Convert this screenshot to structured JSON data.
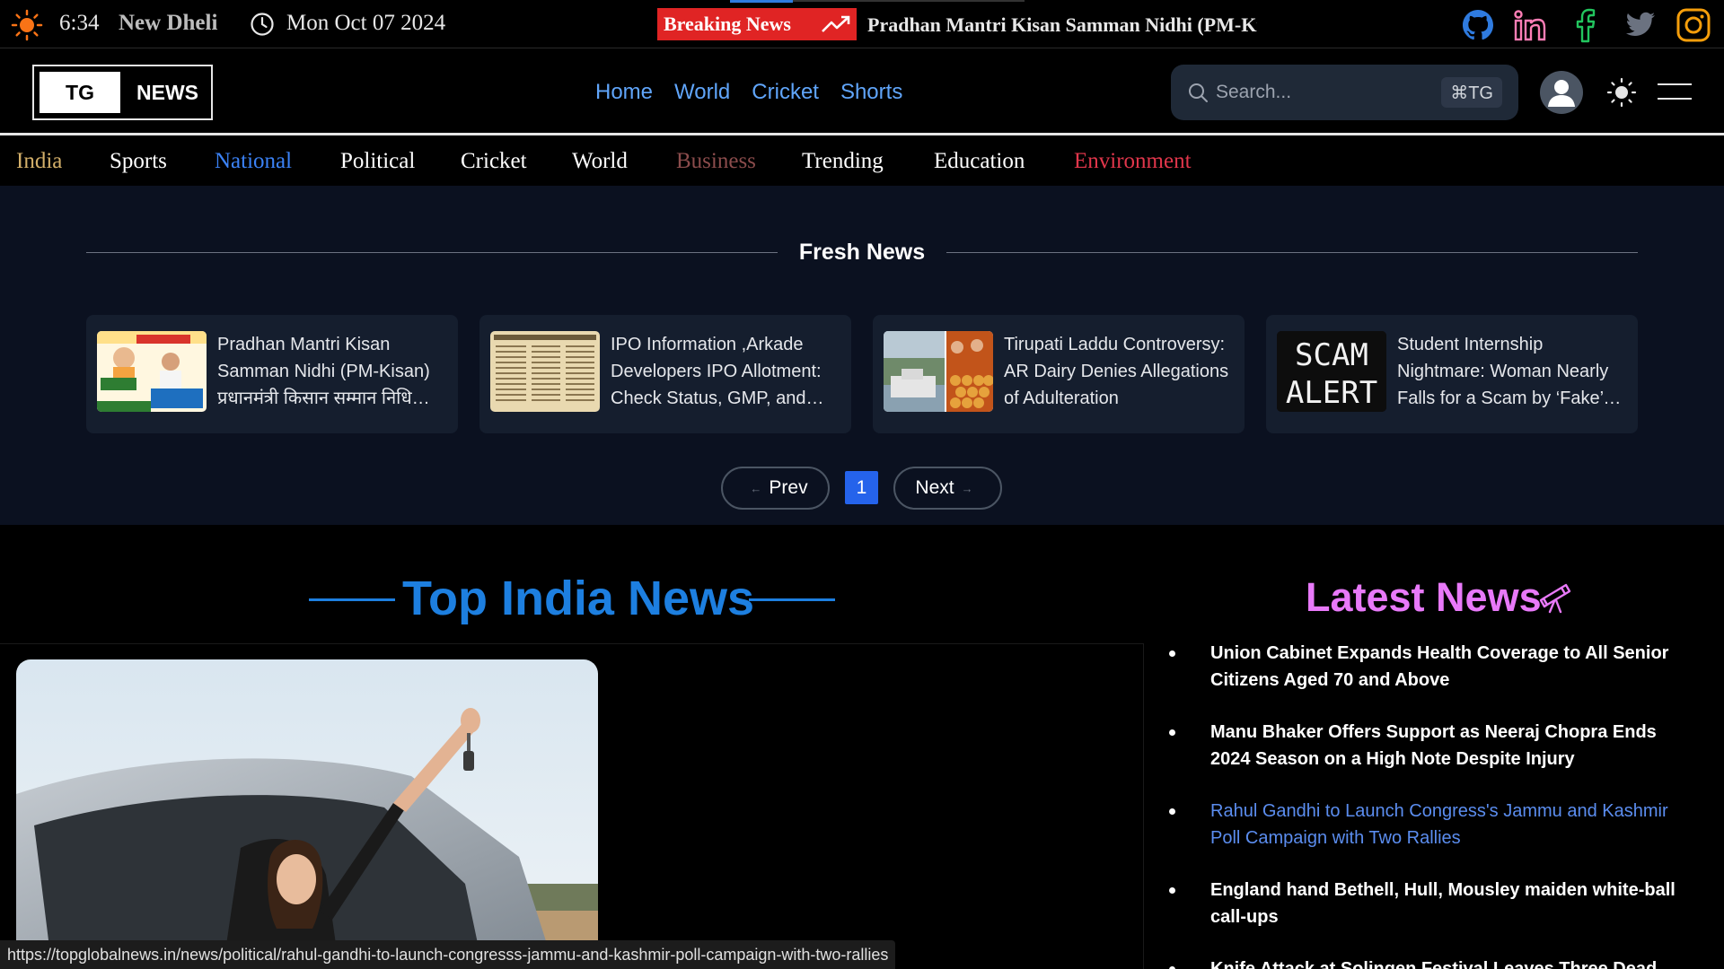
{
  "topbar": {
    "time": "6:34",
    "city": "New Dheli",
    "date": "Mon Oct 07 2024",
    "breaking_label": "Breaking News",
    "ticker_text": "Pradhan Mantri Kisan Samman Nidhi (PM-Kisan) प्रधानमंत्री किसान सम्मान निधि",
    "social_icons": [
      "github-icon",
      "linkedin-icon",
      "facebook-icon",
      "twitter-icon",
      "instagram-icon"
    ]
  },
  "header": {
    "logo_left": "TG",
    "logo_right": "NEWS",
    "nav": [
      "Home",
      "World",
      "Cricket",
      "Shorts"
    ],
    "search_placeholder": "Search...",
    "search_shortcut": "⌘TG"
  },
  "categories": [
    {
      "label": "India",
      "color": "#d4b06a"
    },
    {
      "label": "Sports",
      "color": "#ffffff"
    },
    {
      "label": "National",
      "color": "#3b82f6"
    },
    {
      "label": "Political",
      "color": "#ffffff"
    },
    {
      "label": "Cricket",
      "color": "#ffffff"
    },
    {
      "label": "World",
      "color": "#ffffff"
    },
    {
      "label": "Business",
      "color": "#8b4c4c"
    },
    {
      "label": "Trending",
      "color": "#ffffff"
    },
    {
      "label": "Education",
      "color": "#ffffff"
    },
    {
      "label": "Environment",
      "color": "#e1364b"
    }
  ],
  "fresh_news": {
    "title": "Fresh News",
    "cards": [
      {
        "text": "Pradhan Mantri Kisan Samman Nidhi (PM-Kisan) प्रधानमंत्री किसान सम्मान निधि (पीएम-किसान)"
      },
      {
        "text": "IPO Information ,Arkade Developers IPO Allotment: Check Status, GMP, and Listing Date"
      },
      {
        "text": "Tirupati Laddu Controversy: AR Dairy Denies Allegations of Adulteration"
      },
      {
        "text": "Student Internship Nightmare: Woman Nearly Falls for a Scam by ‘Fake’ Recruiters"
      }
    ],
    "thumb_scam_lines": [
      "SCAM",
      "ALERT"
    ],
    "prev_label": "Prev",
    "next_label": "Next",
    "current_page": "1"
  },
  "top_india_news": {
    "title": "Top India News"
  },
  "latest_news": {
    "title": "Latest News",
    "items": [
      {
        "text": "Union Cabinet Expands Health Coverage to All Senior Citizens Aged 70 and Above",
        "active": false
      },
      {
        "text": "Manu Bhaker Offers Support as Neeraj Chopra Ends 2024 Season on a High Note Despite Injury",
        "active": false
      },
      {
        "text": "Rahul Gandhi to Launch Congress's Jammu and Kashmir Poll Campaign with Two Rallies",
        "active": true
      },
      {
        "text": "England hand Bethell, Hull, Mousley maiden white-ball call-ups",
        "active": false
      },
      {
        "text": "Knife Attack at Solingen Festival Leaves Three Dead",
        "active": false
      }
    ]
  },
  "statusbar": {
    "url": "https://topglobalnews.in/news/political/rahul-gandhi-to-launch-congresss-jammu-and-kashmir-poll-campaign-with-two-rallies"
  },
  "colors": {
    "accent_blue": "#1d7fe0",
    "breaking_red": "#e02424",
    "latest_pink": "#e879f9",
    "page_active": "#2563eb"
  }
}
